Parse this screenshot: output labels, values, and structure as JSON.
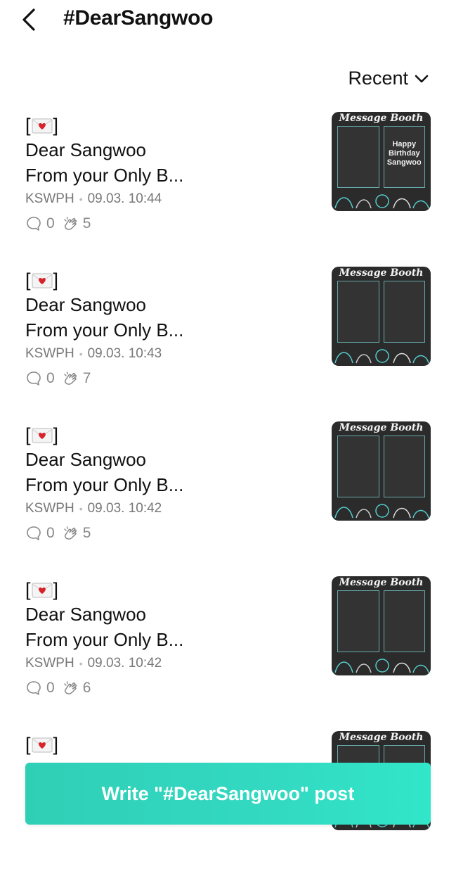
{
  "header": {
    "title": "#DearSangwoo"
  },
  "sort": {
    "label": "Recent"
  },
  "posts": [
    {
      "line1": "Dear Sangwoo",
      "line2": "From your Only B...",
      "author": "KSWPH",
      "time": "09.03. 10:44",
      "comments": "0",
      "likes": "5",
      "thumb": {
        "title": "Message Booth",
        "panel_right": "Happy Birthday Sangwoo"
      }
    },
    {
      "line1": "Dear Sangwoo",
      "line2": "From your Only B...",
      "author": "KSWPH",
      "time": "09.03. 10:43",
      "comments": "0",
      "likes": "7",
      "thumb": {
        "title": "Message Booth",
        "panel_right": ""
      }
    },
    {
      "line1": "Dear Sangwoo",
      "line2": "From your Only B...",
      "author": "KSWPH",
      "time": "09.03. 10:42",
      "comments": "0",
      "likes": "5",
      "thumb": {
        "title": "Message Booth",
        "panel_right": ""
      }
    },
    {
      "line1": "Dear Sangwoo",
      "line2": "From your Only B...",
      "author": "KSWPH",
      "time": "09.03. 10:42",
      "comments": "0",
      "likes": "6",
      "thumb": {
        "title": "Message Booth",
        "panel_right": ""
      }
    },
    {
      "line1": "",
      "line2": "",
      "author": "",
      "time": "",
      "comments": "",
      "likes": "",
      "thumb": {
        "title": "Message Booth",
        "panel_right": ""
      }
    }
  ],
  "write_button": {
    "label": "Write \"#DearSangwoo\" post"
  },
  "colors": {
    "accent": "#33d9c1",
    "meta_text": "#777777"
  }
}
